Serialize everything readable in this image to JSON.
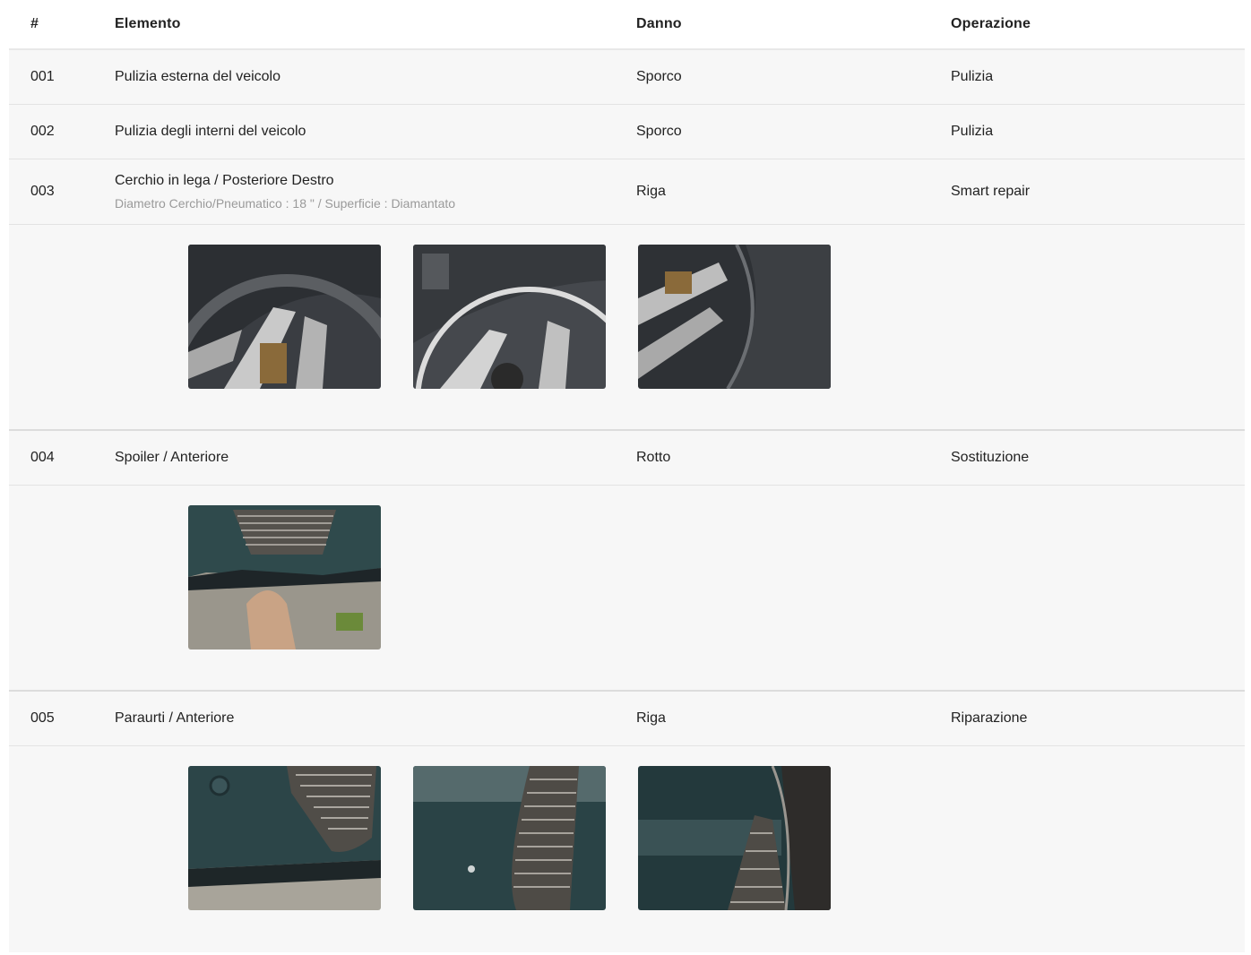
{
  "columns": {
    "num": "#",
    "element": "Elemento",
    "damage": "Danno",
    "operation": "Operazione"
  },
  "rows": [
    {
      "num": "001",
      "element": "Pulizia esterna del veicolo",
      "detail": "",
      "damage": "Sporco",
      "operation": "Pulizia",
      "photos": []
    },
    {
      "num": "002",
      "element": "Pulizia degli interni del veicolo",
      "detail": "",
      "damage": "Sporco",
      "operation": "Pulizia",
      "photos": []
    },
    {
      "num": "003",
      "element": "Cerchio in lega / Posteriore Destro",
      "detail": "Diametro Cerchio/Pneumatico : 18 \" / Superficie : Diamantato",
      "damage": "Riga",
      "operation": "Smart repair",
      "photos": [
        "wheel-photo-1",
        "wheel-photo-2",
        "wheel-photo-3"
      ]
    },
    {
      "num": "004",
      "element": "Spoiler / Anteriore",
      "detail": "",
      "damage": "Rotto",
      "operation": "Sostituzione",
      "photos": [
        "spoiler-photo-1"
      ]
    },
    {
      "num": "005",
      "element": "Paraurti / Anteriore",
      "detail": "",
      "damage": "Riga",
      "operation": "Riparazione",
      "photos": [
        "bumper-photo-1",
        "bumper-photo-2",
        "bumper-photo-3"
      ]
    }
  ],
  "colors": {
    "row_bg": "#f7f7f7",
    "divider": "#e3e3e3",
    "sub_text": "#9a9a9a"
  }
}
